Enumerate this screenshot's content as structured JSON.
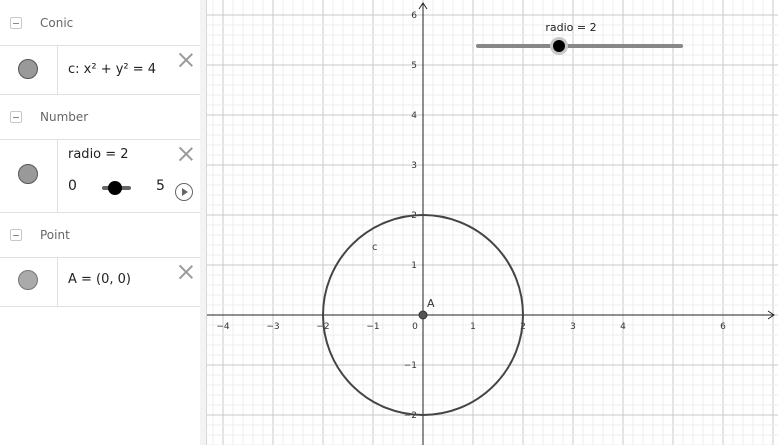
{
  "algebra": {
    "groups": [
      {
        "label": "Conic",
        "items": [
          {
            "formula": "c: x² + y² = 4",
            "color": "#999999"
          }
        ]
      },
      {
        "label": "Number",
        "items": [
          {
            "formula": "radio = 2",
            "color": "#999999",
            "slider": {
              "min": "0",
              "max": "5",
              "value": 2
            }
          }
        ]
      },
      {
        "label": "Point",
        "items": [
          {
            "formula": "A = (0, 0)",
            "color": "#aaaaaa"
          }
        ]
      }
    ]
  },
  "graphics": {
    "x_ticks": [
      "−4",
      "−3",
      "−2",
      "−1",
      "0",
      "1",
      "2",
      "3",
      "4",
      "6"
    ],
    "y_ticks": [
      "6",
      "5",
      "4",
      "3",
      "2",
      "1",
      "−1",
      "−2"
    ],
    "circle_label": "c",
    "point_label": "A",
    "slider": {
      "label": "radio = 2",
      "value": 2,
      "min": 0,
      "max": 5
    },
    "circle": {
      "center": [
        0,
        0
      ],
      "radius": 2,
      "color": "#444444"
    },
    "point": {
      "x": 0,
      "y": 0,
      "color": "#555555"
    }
  }
}
